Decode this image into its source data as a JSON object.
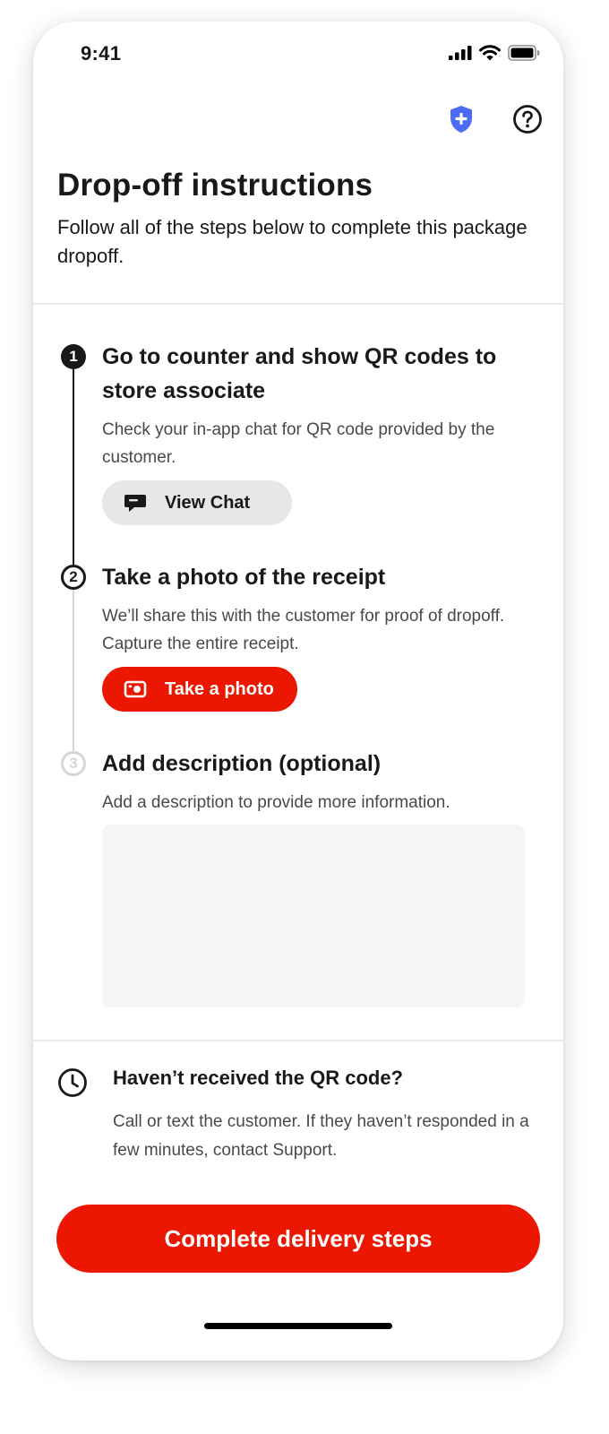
{
  "status_bar": {
    "time": "9:41",
    "icons": [
      "signal-icon",
      "wifi-icon",
      "battery-icon"
    ]
  },
  "header": {
    "icons": [
      "shield-plus-icon",
      "help-icon"
    ],
    "shield_color": "#4B6BF5",
    "title": "Drop-off instructions",
    "subtitle": "Follow all of the steps below to complete this package dropoff."
  },
  "steps": [
    {
      "number": "1",
      "state": "done",
      "title": "Go to counter and show QR codes to store associate",
      "body": "Check your in-app chat for QR code provided by the customer.",
      "button_label": "View Chat",
      "button_icon": "chat-bubble-icon"
    },
    {
      "number": "2",
      "state": "active",
      "title": "Take a photo of the receipt",
      "body": "We’ll share this with the customer for proof of dropoff. Capture the entire receipt.",
      "button_label": "Take a photo",
      "button_icon": "camera-icon"
    },
    {
      "number": "3",
      "state": "todo",
      "title": "Add description (optional)",
      "body": "Add a description to provide more information.",
      "input_value": "",
      "input_placeholder": ""
    }
  ],
  "qr_help": {
    "icon": "clock-icon",
    "title": "Haven’t received the QR code?",
    "body": "Call or text the customer. If they haven’t responded in a few minutes, contact Support."
  },
  "cta": {
    "label": "Complete delivery steps"
  },
  "colors": {
    "primary_red": "#EB1700",
    "text": "#191919",
    "secondary_text": "#494949",
    "pill_gray": "#E7E7E7",
    "inactive_step": "#D6D6D6",
    "input_background": "#F5F5F5"
  }
}
